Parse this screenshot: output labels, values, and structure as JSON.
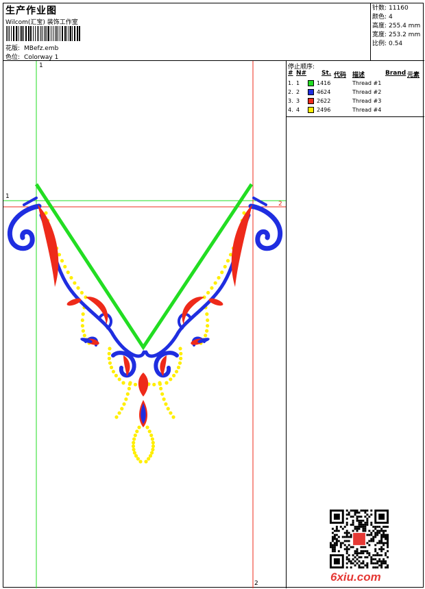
{
  "header": {
    "title": "生产作业图",
    "company": "Wilcom(汇宝) 装饰工作室",
    "design_label": "花版:",
    "design_value": "MBefz.emb",
    "colorway_label": "色位:",
    "colorway_value": "Colorway 1"
  },
  "stats": [
    {
      "label": "针数:",
      "value": "11160"
    },
    {
      "label": "颜色:",
      "value": "4"
    },
    {
      "label": "高度:",
      "value": "255.4 mm"
    },
    {
      "label": "宽度:",
      "value": "253.2 mm"
    },
    {
      "label": "比例:",
      "value": "0.54"
    }
  ],
  "stop_sequence": {
    "title": "停止顺序:",
    "columns": [
      "#",
      "N#",
      "St.",
      "代码",
      "描述",
      "Brand",
      "元素"
    ],
    "rows": [
      {
        "num": "1.",
        "n": "1",
        "color": "#22dd22",
        "code": "1416",
        "desc": "Thread #1"
      },
      {
        "num": "2.",
        "n": "2",
        "color": "#1f2ee0",
        "code": "4624",
        "desc": "Thread #2"
      },
      {
        "num": "3.",
        "n": "3",
        "color": "#ee2a1a",
        "code": "2622",
        "desc": "Thread #3"
      },
      {
        "num": "4.",
        "n": "4",
        "color": "#ffee00",
        "code": "2496",
        "desc": "Thread #4"
      }
    ]
  },
  "guides": {
    "green_v": "1",
    "green_h": "1",
    "red_h": "2",
    "red_v": "2"
  },
  "colors": {
    "thread_green": "#22dd22",
    "thread_blue": "#1f2ee0",
    "thread_red": "#ee2a1a",
    "thread_yellow": "#ffee00",
    "watermark": "#e53935"
  },
  "watermark": "6xiu.com"
}
